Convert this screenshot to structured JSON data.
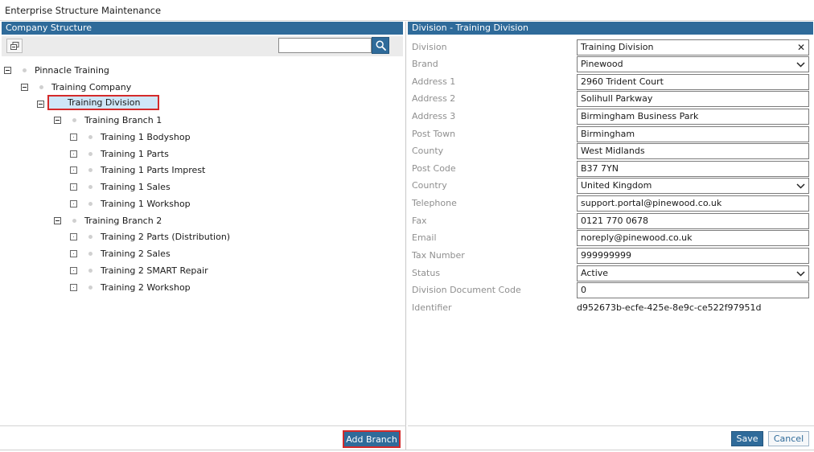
{
  "app": {
    "title": "Enterprise Structure Maintenance"
  },
  "left": {
    "header": "Company Structure",
    "search": {
      "value": "",
      "placeholder": ""
    },
    "add_branch_label": "Add Branch",
    "tree": [
      {
        "label": "Pinnacle Training",
        "type": "minus"
      },
      {
        "label": "Training Company",
        "type": "minus"
      },
      {
        "label": "Training Division",
        "type": "minus",
        "selected": true
      },
      {
        "label": "Training Branch 1",
        "type": "minus"
      },
      {
        "label": "Training 1 Bodyshop",
        "type": "leaf"
      },
      {
        "label": "Training 1 Parts",
        "type": "leaf"
      },
      {
        "label": "Training 1 Parts Imprest",
        "type": "leaf"
      },
      {
        "label": "Training 1 Sales",
        "type": "leaf"
      },
      {
        "label": "Training 1 Workshop",
        "type": "leaf"
      },
      {
        "label": "Training Branch 2",
        "type": "minus"
      },
      {
        "label": "Training 2 Parts (Distribution)",
        "type": "leaf"
      },
      {
        "label": "Training 2 Sales",
        "type": "leaf"
      },
      {
        "label": "Training 2 SMART Repair",
        "type": "leaf"
      },
      {
        "label": "Training 2 Workshop",
        "type": "leaf"
      }
    ]
  },
  "right": {
    "header": "Division - Training Division",
    "save_label": "Save",
    "cancel_label": "Cancel",
    "fields": [
      {
        "label": "Division",
        "value": "Training Division",
        "kind": "clearable"
      },
      {
        "label": "Brand",
        "value": "Pinewood",
        "kind": "select"
      },
      {
        "label": "Address 1",
        "value": "2960 Trident Court",
        "kind": "text"
      },
      {
        "label": "Address 2",
        "value": "Solihull Parkway",
        "kind": "text"
      },
      {
        "label": "Address 3",
        "value": "Birmingham Business Park",
        "kind": "text"
      },
      {
        "label": "Post Town",
        "value": "Birmingham",
        "kind": "text"
      },
      {
        "label": "County",
        "value": "West Midlands",
        "kind": "text"
      },
      {
        "label": "Post Code",
        "value": "B37 7YN",
        "kind": "text"
      },
      {
        "label": "Country",
        "value": "United Kingdom",
        "kind": "select"
      },
      {
        "label": "Telephone",
        "value": "support.portal@pinewood.co.uk",
        "kind": "text"
      },
      {
        "label": "Fax",
        "value": "0121 770 0678",
        "kind": "text"
      },
      {
        "label": "Email",
        "value": "noreply@pinewood.co.uk",
        "kind": "text"
      },
      {
        "label": "Tax Number",
        "value": "999999999",
        "kind": "text"
      },
      {
        "label": "Status",
        "value": "Active",
        "kind": "select"
      },
      {
        "label": "Division Document Code",
        "value": "0",
        "kind": "text"
      },
      {
        "label": "Identifier",
        "value": "d952673b-ecfe-425e-8e9c-ce522f97951d",
        "kind": "readonly"
      }
    ]
  }
}
